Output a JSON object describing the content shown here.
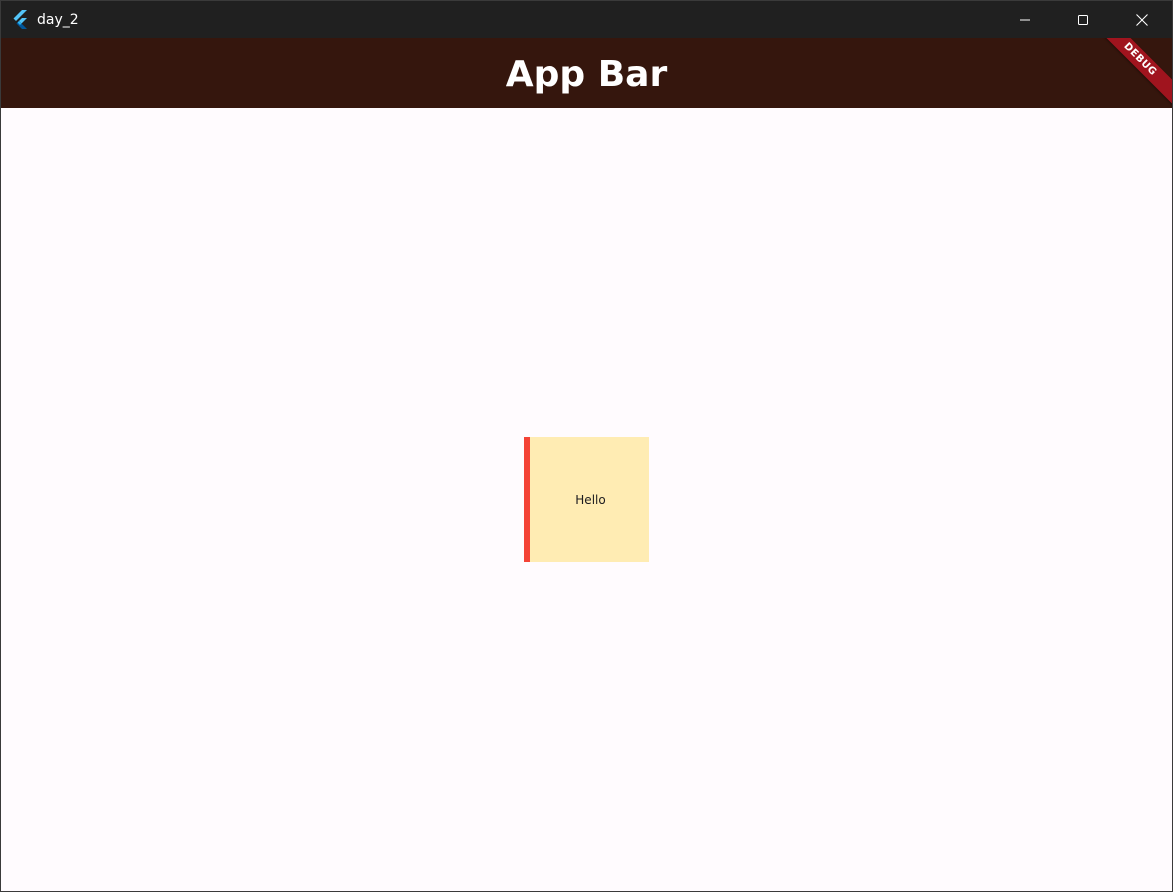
{
  "window": {
    "title": "day_2",
    "icon": "flutter-logo-icon",
    "controls": {
      "minimize_icon": "minimize-icon",
      "maximize_icon": "maximize-icon",
      "close_icon": "close-icon"
    }
  },
  "appbar": {
    "title": "App Bar",
    "background": "#35160d",
    "debug_banner": "DEBUG"
  },
  "content": {
    "box_text": "Hello",
    "box_color": "#ffecb3",
    "box_border_color": "#f44336",
    "background": "#fffbfe"
  }
}
